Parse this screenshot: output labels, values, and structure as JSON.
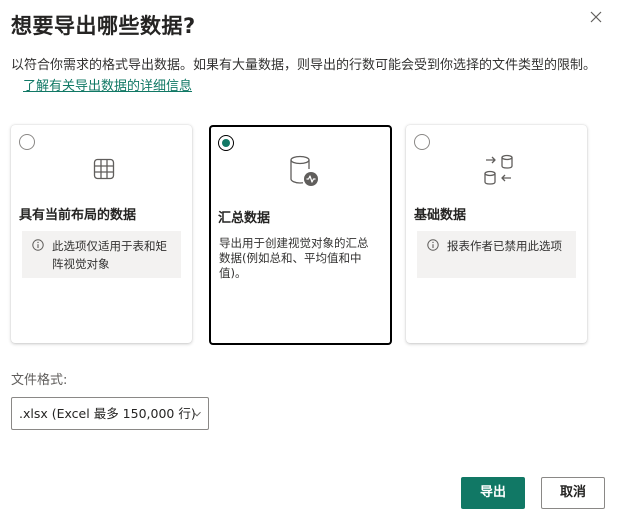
{
  "dialog": {
    "title": "想要导出哪些数据?",
    "description": "以符合你需求的格式导出数据。如果有大量数据，则导出的行数可能会受到你选择的文件类型的限制。",
    "learn_more_link": "了解有关导出数据的详细信息"
  },
  "options": [
    {
      "title": "具有当前布局的数据",
      "note": "此选项仅适用于表和矩阵视觉对象",
      "icon": "table-grid-icon",
      "selected": false
    },
    {
      "title": "汇总数据",
      "description": "导出用于创建视觉对象的汇总数据(例如总和、平均值和中值)。",
      "icon": "database-pulse-icon",
      "selected": true
    },
    {
      "title": "基础数据",
      "note": "报表作者已禁用此选项",
      "icon": "database-transfer-icon",
      "selected": false
    }
  ],
  "file_format": {
    "label": "文件格式:",
    "selected": ".xlsx (Excel 最多 150,000 行)"
  },
  "buttons": {
    "export": "导出",
    "cancel": "取消"
  },
  "colors": {
    "accent": "#117865",
    "info_background": "#f3f2f1"
  }
}
